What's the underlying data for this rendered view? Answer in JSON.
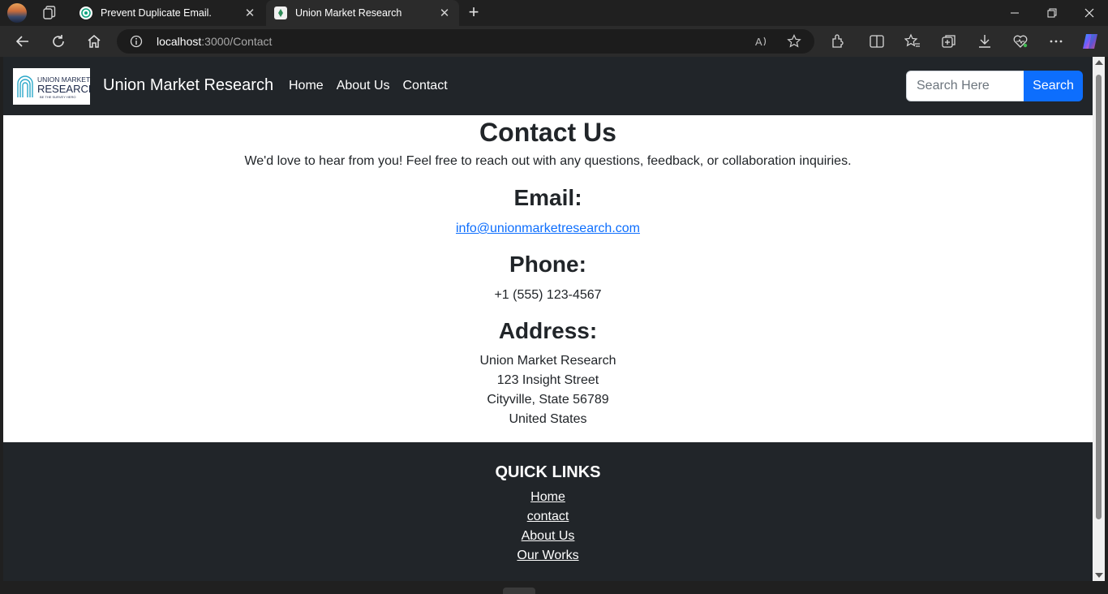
{
  "browser": {
    "tabs": [
      {
        "title": "Prevent Duplicate Email.",
        "active": false
      },
      {
        "title": "Union Market Research",
        "active": true
      }
    ],
    "url_host": "localhost",
    "url_path": ":3000/Contact"
  },
  "navbar": {
    "logo_line1": "UNION MARKET",
    "logo_line2": "RESEARCH",
    "logo_tagline": "BE THE SURVEY HERO",
    "brand": "Union Market Research",
    "links": [
      "Home",
      "About Us",
      "Contact"
    ],
    "search_placeholder": "Search Here",
    "search_button": "Search"
  },
  "contact": {
    "title": "Contact Us",
    "intro": "We'd love to hear from you! Feel free to reach out with any questions, feedback, or collaboration inquiries.",
    "email_heading": "Email:",
    "email": "info@unionmarketresearch.com",
    "phone_heading": "Phone:",
    "phone": "+1 (555) 123-4567",
    "address_heading": "Address:",
    "address_lines": [
      "Union Market Research",
      "123 Insight Street",
      "Cityville, State 56789",
      "United States"
    ]
  },
  "footer": {
    "heading": "QUICK LINKS",
    "links": [
      "Home",
      "contact",
      "About Us",
      "Our Works"
    ]
  },
  "colors": {
    "navbar_bg": "#212529",
    "primary": "#0d6efd"
  }
}
